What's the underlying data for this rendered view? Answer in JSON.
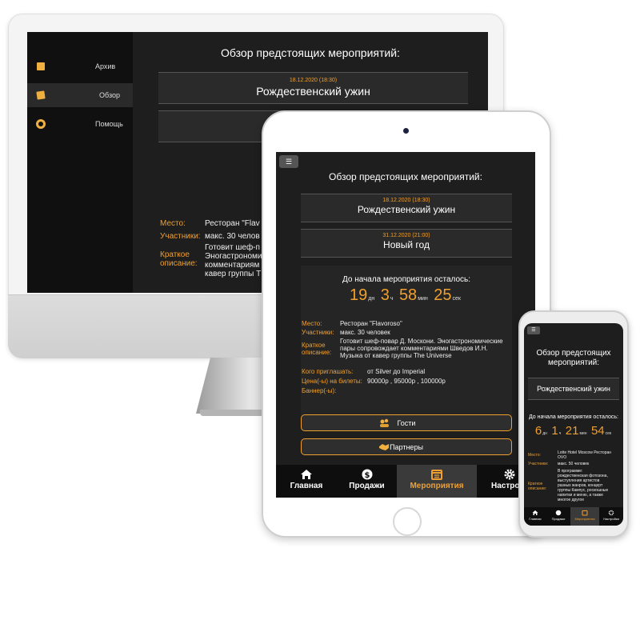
{
  "desktop": {
    "sidebar": [
      {
        "label": "Архив",
        "icon": "archive-icon"
      },
      {
        "label": "Обзор",
        "icon": "overview-icon"
      },
      {
        "label": "Помощь",
        "icon": "help-icon"
      }
    ],
    "title": "Обзор предстоящих мероприятий:",
    "events": [
      {
        "date": "18.12.2020 (18:30)",
        "name": "Рождественский ужин"
      }
    ],
    "details": {
      "place_label": "Место:",
      "place_value": "Ресторан \"Flav",
      "participants_label": "Участники:",
      "participants_value": "макс. 30 челов",
      "desc_label_1": "Краткое",
      "desc_label_2": "описание:",
      "desc_line_1": "Готовит шеф-п",
      "desc_line_2": "Эногастрономи",
      "desc_line_3": "комментариям",
      "desc_line_4": "кавер группы T"
    }
  },
  "tablet": {
    "menu_icon": "☰",
    "title": "Обзор предстоящих мероприятий:",
    "events": [
      {
        "date": "18.12.2020 (18:30)",
        "name": "Рождественский ужин"
      },
      {
        "date": "31.12.2020 (21:00)",
        "name": "Новый год"
      }
    ],
    "countdown": {
      "label": "До начала мероприятия осталось:",
      "days": "19",
      "days_unit": "дн",
      "hours": "3",
      "hours_unit": "ч",
      "minutes": "58",
      "minutes_unit": "мин",
      "seconds": "25",
      "seconds_unit": "сек"
    },
    "details": {
      "place_label": "Место:",
      "place_value": "Ресторан \"Flavoroso\"",
      "participants_label": "Участники:",
      "participants_value": "макс. 30 человек",
      "desc_label_1": "Краткое",
      "desc_label_2": "описание:",
      "desc_line_1": "Готовит шеф-повар Д. Москони. Эногастрономические",
      "desc_line_2": "пары сопровождает комментариями Шведов И.Н.",
      "desc_line_3": "Музыка от кавер группы The Universe",
      "invite_label": "Кого приглашать:",
      "invite_value": "от Silver до Imperial",
      "price_label": "Цена(-ы) на билеты:",
      "price_value": "90000р , 95000р , 100000р",
      "banner_label": "Баннер(-ы):"
    },
    "buttons": {
      "guests": "Гости",
      "partners": "Партнеры"
    },
    "tabs": [
      {
        "label": "Главная",
        "icon": "home-icon"
      },
      {
        "label": "Продажи",
        "icon": "dollar-icon"
      },
      {
        "label": "Мероприятия",
        "icon": "calendar-icon",
        "active": true
      },
      {
        "label": "Настро",
        "icon": "gear-icon"
      }
    ]
  },
  "phone": {
    "menu_icon": "☰",
    "title": "Обзор предстоящих мероприятий:",
    "event_name": "Рождественский ужин",
    "countdown": {
      "label": "До начала мероприятия осталось:",
      "days": "6",
      "days_unit": "дн",
      "hours": "1",
      "hours_unit": "ч",
      "minutes": "21",
      "minutes_unit": "мин",
      "seconds": "54",
      "seconds_unit": "сек"
    },
    "details": {
      "place_label": "Место:",
      "place_value_1": "Lotte Hotel Moscow Ресторан",
      "place_value_2": "OVO",
      "participants_label": "Участники:",
      "participants_value": "макс. 50 человек",
      "desc_label_1": "Краткое",
      "desc_label_2": "описание:",
      "desc_line_1": "В программе:",
      "desc_line_2": "рождественская фотозона,",
      "desc_line_3": "выступления артистов",
      "desc_line_4": "разных жанров, концерт",
      "desc_line_5": "группы Кампус, роскошные",
      "desc_line_6": "напитки и меню, а также",
      "desc_line_7": "многое другое"
    },
    "tabs": [
      {
        "label": "Главная",
        "icon": "home-icon"
      },
      {
        "label": "Продажи",
        "icon": "dollar-icon"
      },
      {
        "label": "Мероприятия",
        "icon": "calendar-icon",
        "active": true
      },
      {
        "label": "Настройки",
        "icon": "gear-icon"
      }
    ]
  }
}
